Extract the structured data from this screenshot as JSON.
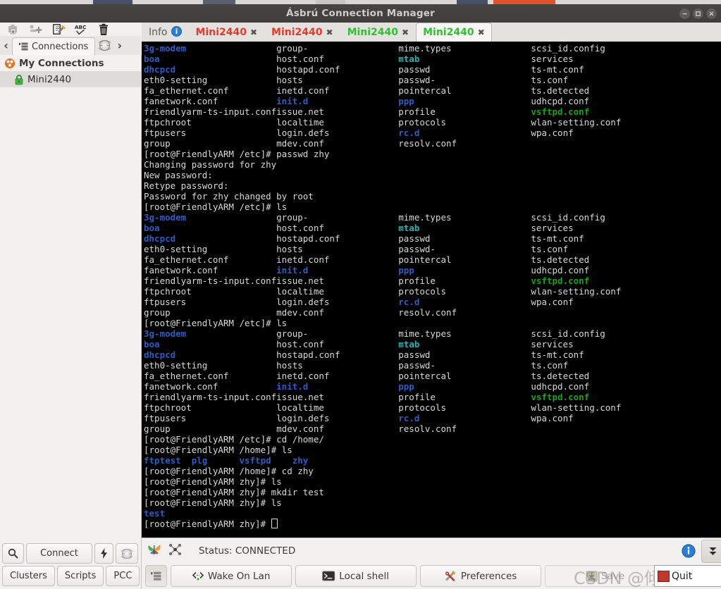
{
  "window": {
    "title": "Ásbrú Connection Manager",
    "controls": [
      "minimize",
      "maximize",
      "close"
    ]
  },
  "left_toolbar": {
    "icons": [
      {
        "name": "new-group-icon",
        "glyph": "folder-plus"
      },
      {
        "name": "new-connection-icon",
        "glyph": "node-plus"
      },
      {
        "name": "edit-connection-icon",
        "glyph": "pencil-doc"
      },
      {
        "name": "spellcheck-icon",
        "glyph": "ABC"
      },
      {
        "name": "delete-icon",
        "glyph": "trash"
      }
    ]
  },
  "connections_panel": {
    "prev_arrow": "‹",
    "next_arrow": "›",
    "tab_label": "Connections",
    "globe_icon": "globe-icon",
    "tree": [
      {
        "label": "My Connections",
        "icon": "group-icon",
        "selected": false,
        "level": 0
      },
      {
        "label": "Mini2440",
        "icon": "lock-icon",
        "selected": true,
        "level": 1
      }
    ]
  },
  "bottom_left_buttons": {
    "row1": [
      {
        "label": "",
        "icon": "search-icon",
        "name": "search-button"
      },
      {
        "label": "Connect",
        "icon": "",
        "name": "connect-button"
      },
      {
        "label": "",
        "icon": "bolt-icon",
        "name": "quick-connect-button"
      },
      {
        "label": "",
        "icon": "globe-icon",
        "name": "globe-button"
      }
    ],
    "row2": [
      {
        "label": "Clusters",
        "name": "clusters-button"
      },
      {
        "label": "Scripts",
        "name": "scripts-button"
      },
      {
        "label": "PCC",
        "name": "pcc-button"
      }
    ]
  },
  "terminal_tabs": [
    {
      "label": "Info",
      "icon": "info-icon",
      "color": "#5b5b5b",
      "closable": false,
      "active": false
    },
    {
      "label": "Mini2440",
      "color": "#e8392b",
      "closable": true,
      "active": false
    },
    {
      "label": "Mini2440",
      "color": "#e8392b",
      "closable": true,
      "active": false
    },
    {
      "label": "Mini2440",
      "color": "#31c031",
      "closable": true,
      "active": false
    },
    {
      "label": "Mini2440",
      "color": "#31c031",
      "closable": true,
      "active": true
    }
  ],
  "terminal": {
    "colors": {
      "background": "#000000",
      "default": "#d8d8d8",
      "directory": "#2b5dc9",
      "cyan": "#23b3b3",
      "green": "#19a319"
    },
    "prompt_etc": "[root@FriendlyARM /etc]# ",
    "prompt_home": "[root@FriendlyARM /home]# ",
    "prompt_zhy": "[root@FriendlyARM zhy]# ",
    "ls_columns": [
      [
        {
          "t": "3g-modem",
          "c": "dir"
        },
        {
          "t": "boa",
          "c": "dir"
        },
        {
          "t": "dhcpcd",
          "c": "dir"
        },
        {
          "t": "eth0-setting",
          "c": "def"
        },
        {
          "t": "fa_ethernet.conf",
          "c": "def"
        },
        {
          "t": "fanetwork.conf",
          "c": "def"
        },
        {
          "t": "friendlyarm-ts-input.conf",
          "c": "def"
        },
        {
          "t": "ftpchroot",
          "c": "def"
        },
        {
          "t": "ftpusers",
          "c": "def"
        },
        {
          "t": "group",
          "c": "def"
        }
      ],
      [
        {
          "t": "group-",
          "c": "def"
        },
        {
          "t": "host.conf",
          "c": "def"
        },
        {
          "t": "hostapd.conf",
          "c": "def"
        },
        {
          "t": "hosts",
          "c": "def"
        },
        {
          "t": "inetd.conf",
          "c": "def"
        },
        {
          "t": "init.d",
          "c": "dir"
        },
        {
          "t": "issue.net",
          "c": "def"
        },
        {
          "t": "localtime",
          "c": "def"
        },
        {
          "t": "login.defs",
          "c": "def"
        },
        {
          "t": "mdev.conf",
          "c": "def"
        }
      ],
      [
        {
          "t": "mime.types",
          "c": "def"
        },
        {
          "t": "mtab",
          "c": "cyan"
        },
        {
          "t": "passwd",
          "c": "def"
        },
        {
          "t": "passwd-",
          "c": "def"
        },
        {
          "t": "pointercal",
          "c": "def"
        },
        {
          "t": "ppp",
          "c": "dir"
        },
        {
          "t": "profile",
          "c": "def"
        },
        {
          "t": "protocols",
          "c": "def"
        },
        {
          "t": "rc.d",
          "c": "dir"
        },
        {
          "t": "resolv.conf",
          "c": "def"
        }
      ],
      [
        {
          "t": "scsi_id.config",
          "c": "def"
        },
        {
          "t": "services",
          "c": "def"
        },
        {
          "t": "ts-mt.conf",
          "c": "def"
        },
        {
          "t": "ts.conf",
          "c": "def"
        },
        {
          "t": "ts.detected",
          "c": "def"
        },
        {
          "t": "udhcpd.conf",
          "c": "def"
        },
        {
          "t": "vsftpd.conf",
          "c": "grn"
        },
        {
          "t": "wlan-setting.conf",
          "c": "def"
        },
        {
          "t": "wpa.conf",
          "c": "def"
        },
        {
          "t": "",
          "c": "def"
        }
      ]
    ],
    "passwd_session": [
      "[root@FriendlyARM /etc]# passwd zhy",
      "Changing password for zhy",
      "New password:",
      "Retype password:",
      "Password for zhy changed by root"
    ],
    "tail_lines": [
      {
        "t": "[root@FriendlyARM /etc]# cd /home/",
        "c": "def"
      },
      {
        "t": "[root@FriendlyARM /home]# ls",
        "c": "def"
      },
      {
        "t": "HOME_LS",
        "c": "special"
      },
      {
        "t": "[root@FriendlyARM /home]# cd zhy",
        "c": "def"
      },
      {
        "t": "[root@FriendlyARM zhy]# ls",
        "c": "def"
      },
      {
        "t": "[root@FriendlyARM zhy]# mkdir test",
        "c": "def"
      },
      {
        "t": "[root@FriendlyARM zhy]# ls",
        "c": "def"
      },
      {
        "t": "test",
        "c": "dir"
      },
      {
        "t": "PROMPT_CURSOR",
        "c": "special"
      }
    ],
    "home_listing": [
      "ftptest",
      "plg",
      "vsftpd",
      "zhy"
    ],
    "ls_cmd_etc": "[root@FriendlyARM /etc]# ls",
    "cursor_prompt": "[root@FriendlyARM zhy]# "
  },
  "status_bar": {
    "status_text": "Status: CONNECTED",
    "left_icons": [
      "butterfly-icon",
      "cluster-icon"
    ],
    "right_buttons": [
      {
        "name": "info-button",
        "icon": "info-icon"
      },
      {
        "name": "expand-down-button",
        "icon": "double-chevron-down-icon"
      }
    ]
  },
  "bottom_bar": {
    "buttons": [
      {
        "label": "",
        "icon": "list-icon",
        "name": "toggle-panel-button",
        "state": "pressed"
      },
      {
        "label": "Wake On Lan",
        "icon": "wol-icon",
        "name": "wake-on-lan-button",
        "state": "normal"
      },
      {
        "label": "Local shell",
        "icon": "terminal-icon",
        "name": "local-shell-button",
        "state": "normal"
      },
      {
        "label": "Preferences",
        "icon": "tools-icon",
        "name": "preferences-button",
        "state": "normal"
      },
      {
        "label": "Save",
        "icon": "save-icon",
        "name": "save-button",
        "state": "disabled"
      },
      {
        "label": "Quit",
        "icon": "quit-icon",
        "name": "quit-button",
        "state": "normal"
      }
    ]
  },
  "watermark": {
    "text": "CSDN @倾我一世柔情"
  },
  "overlay": {
    "text": "Quit"
  }
}
